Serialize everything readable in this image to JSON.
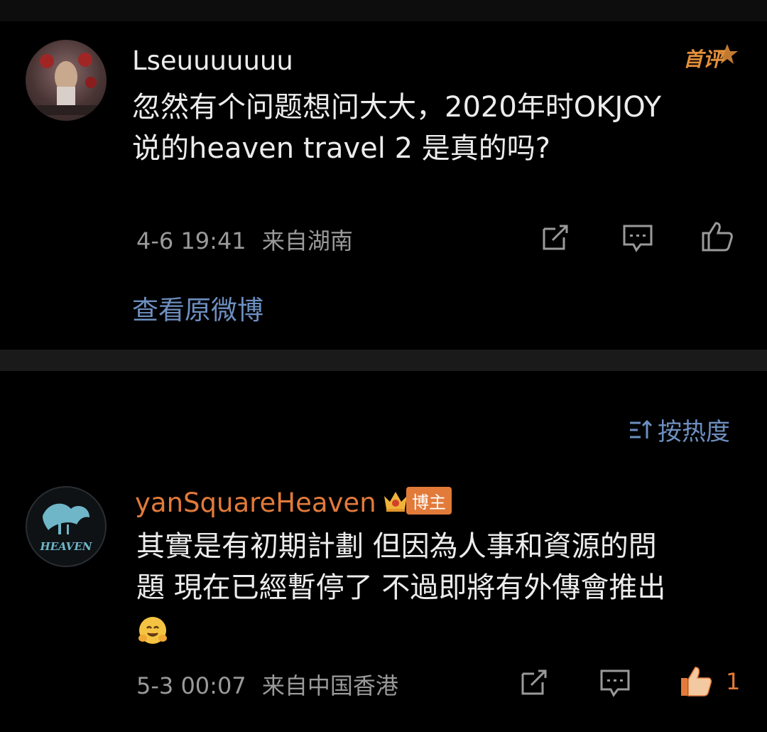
{
  "comment1": {
    "username": "Lseuuuuuuu",
    "badge": "首评",
    "text_line1": "忽然有个问题想问大大，2020年时OKJOY",
    "text_line2": "说的heaven travel 2 是真的吗?",
    "time": "4-6 19:41",
    "location": "来自湖南",
    "view_original": "查看原微博"
  },
  "sort": {
    "label": "按热度",
    "icon": "sort-icon"
  },
  "comment2": {
    "username": "yanSquareHeaven",
    "owner_tag": "博主",
    "text_line1": "其實是有初期計劃 但因為人事和資源的問",
    "text_line2": "題 現在已經暫停了 不過即將有外傳會推出",
    "emoji": "hugging-face-emoji",
    "time": "5-3 00:07",
    "location": "来自中国香港",
    "like_count": "1",
    "avatar_text": "HEAVEN"
  },
  "colors": {
    "background": "#000000",
    "link_blue": "#6d8fc0",
    "accent_orange": "#e27a3a",
    "meta_gray": "#9a9a9a"
  }
}
